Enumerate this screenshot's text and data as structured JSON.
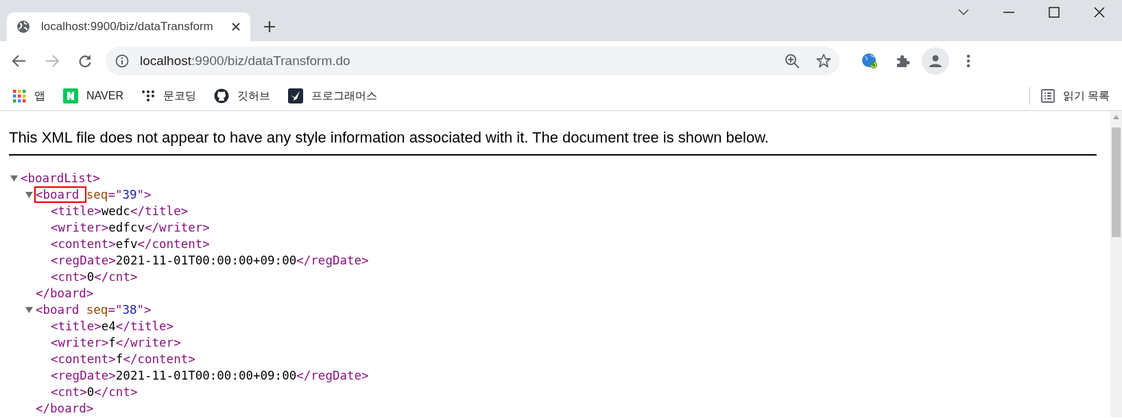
{
  "tab": {
    "title": "localhost:9900/biz/dataTransform",
    "selected": true
  },
  "navigation": {
    "back_disabled": false,
    "forward_disabled": true
  },
  "address_bar": {
    "host": "localhost",
    "path": ":9900/biz/dataTransform.do"
  },
  "bookmarks": [
    {
      "kind": "apps",
      "label": "앱"
    },
    {
      "kind": "naver",
      "label": "NAVER"
    },
    {
      "kind": "dots",
      "label": "문코딩"
    },
    {
      "kind": "github",
      "label": "깃허브"
    },
    {
      "kind": "programmers",
      "label": "프로그래머스"
    }
  ],
  "reading_list": "읽기 목록",
  "notice": "This XML file does not appear to have any style information associated with it. The document tree is shown below.",
  "xml_tree": {
    "line": [
      {
        "kind": "tag",
        "text": "<boardList>"
      }
    ],
    "expanded": true,
    "children": [
      {
        "line": [
          {
            "kind": "tag",
            "text": "<board "
          },
          {
            "kind": "attr_name",
            "text": "seq"
          },
          {
            "kind": "tag",
            "text": "=\""
          },
          {
            "kind": "attr_value",
            "text": "39"
          },
          {
            "kind": "tag",
            "text": "\">"
          }
        ],
        "expanded": true,
        "highlighted": true,
        "closing": "</board>",
        "children": [
          {
            "line": [
              {
                "kind": "tag",
                "text": "<title>"
              },
              {
                "kind": "text",
                "text": "wedc"
              },
              {
                "kind": "tag",
                "text": "</title>"
              }
            ]
          },
          {
            "line": [
              {
                "kind": "tag",
                "text": "<writer>"
              },
              {
                "kind": "text",
                "text": "edfcv"
              },
              {
                "kind": "tag",
                "text": "</writer>"
              }
            ]
          },
          {
            "line": [
              {
                "kind": "tag",
                "text": "<content>"
              },
              {
                "kind": "text",
                "text": "efv"
              },
              {
                "kind": "tag",
                "text": "</content>"
              }
            ]
          },
          {
            "line": [
              {
                "kind": "tag",
                "text": "<regDate>"
              },
              {
                "kind": "text",
                "text": "2021-11-01T00:00:00+09:00"
              },
              {
                "kind": "tag",
                "text": "</regDate>"
              }
            ]
          },
          {
            "line": [
              {
                "kind": "tag",
                "text": "<cnt>"
              },
              {
                "kind": "text",
                "text": "0"
              },
              {
                "kind": "tag",
                "text": "</cnt>"
              }
            ]
          }
        ]
      },
      {
        "line": [
          {
            "kind": "tag",
            "text": "<board "
          },
          {
            "kind": "attr_name",
            "text": "seq"
          },
          {
            "kind": "tag",
            "text": "=\""
          },
          {
            "kind": "attr_value",
            "text": "38"
          },
          {
            "kind": "tag",
            "text": "\">"
          }
        ],
        "expanded": true,
        "highlighted": false,
        "closing": "</board>",
        "children": [
          {
            "line": [
              {
                "kind": "tag",
                "text": "<title>"
              },
              {
                "kind": "text",
                "text": "e4"
              },
              {
                "kind": "tag",
                "text": "</title>"
              }
            ]
          },
          {
            "line": [
              {
                "kind": "tag",
                "text": "<writer>"
              },
              {
                "kind": "text",
                "text": "f"
              },
              {
                "kind": "tag",
                "text": "</writer>"
              }
            ]
          },
          {
            "line": [
              {
                "kind": "tag",
                "text": "<content>"
              },
              {
                "kind": "text",
                "text": "f"
              },
              {
                "kind": "tag",
                "text": "</content>"
              }
            ]
          },
          {
            "line": [
              {
                "kind": "tag",
                "text": "<regDate>"
              },
              {
                "kind": "text",
                "text": "2021-11-01T00:00:00+09:00"
              },
              {
                "kind": "tag",
                "text": "</regDate>"
              }
            ]
          },
          {
            "line": [
              {
                "kind": "tag",
                "text": "<cnt>"
              },
              {
                "kind": "text",
                "text": "0"
              },
              {
                "kind": "tag",
                "text": "</cnt>"
              }
            ]
          }
        ]
      }
    ]
  }
}
